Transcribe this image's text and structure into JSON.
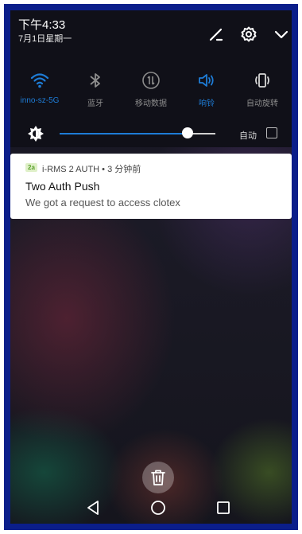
{
  "status": {
    "time": "下午4:33",
    "date": "7月1日星期一"
  },
  "quick_settings": [
    {
      "label": "inno-sz-5G",
      "icon": "wifi-icon",
      "active": true
    },
    {
      "label": "蓝牙",
      "icon": "bluetooth-icon",
      "active": false
    },
    {
      "label": "移动数据",
      "icon": "mobile-data-icon",
      "active": false
    },
    {
      "label": "响铃",
      "icon": "ring-icon",
      "active": true
    },
    {
      "label": "自动旋转",
      "icon": "auto-rotate-icon",
      "active": false
    }
  ],
  "brightness": {
    "level": 0.82,
    "auto_label": "自动",
    "auto_checked": false
  },
  "notification": {
    "app_badge": "2a",
    "app_line": "i-RMS 2 AUTH • 3 分钟前",
    "title": "Two Auth Push",
    "body": "We got a request to access clotex"
  },
  "colors": {
    "accent": "#1e7cd6",
    "inactive": "#8c8c8c",
    "frame": "#0b1e8a"
  }
}
